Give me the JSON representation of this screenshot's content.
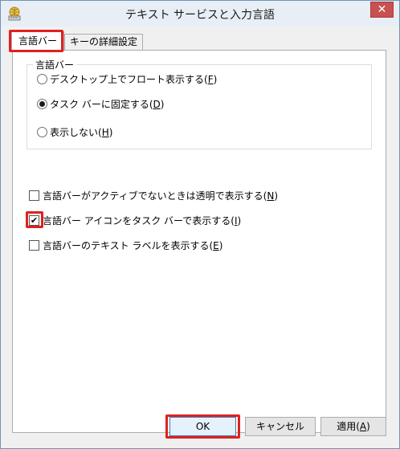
{
  "window": {
    "title": "テキスト サービスと入力言語",
    "close_glyph": "✕"
  },
  "tabs": [
    {
      "label": "言語バー",
      "active": true
    },
    {
      "label": "キーの詳細設定",
      "active": false
    }
  ],
  "group": {
    "title": "言語バー",
    "options": [
      {
        "label": "デスクトップ上でフロート表示する(",
        "key": "F",
        "suffix": ")",
        "selected": false
      },
      {
        "label": "タスク バーに固定する(",
        "key": "D",
        "suffix": ")",
        "selected": true
      },
      {
        "label": "表示しない(",
        "key": "H",
        "suffix": ")",
        "selected": false
      }
    ]
  },
  "checkboxes": [
    {
      "label": "言語バーがアクティブでないときは透明で表示する(",
      "key": "N",
      "suffix": ")",
      "checked": false
    },
    {
      "label": "言語バー アイコンをタスク バーで表示する(",
      "key": "I",
      "suffix": ")",
      "checked": true
    },
    {
      "label": "言語バーのテキスト ラベルを表示する(",
      "key": "E",
      "suffix": ")",
      "checked": false
    }
  ],
  "buttons": {
    "ok": "OK",
    "cancel": "キャンセル",
    "apply": "適用(",
    "apply_key": "A",
    "apply_suffix": ")"
  },
  "colors": {
    "highlight": "#e02020",
    "title_bar": "#e8eef5",
    "close_button": "#c75050"
  },
  "icons": {
    "app": "globe-keyboard-icon",
    "close": "close-icon",
    "check": "checkmark-icon"
  }
}
